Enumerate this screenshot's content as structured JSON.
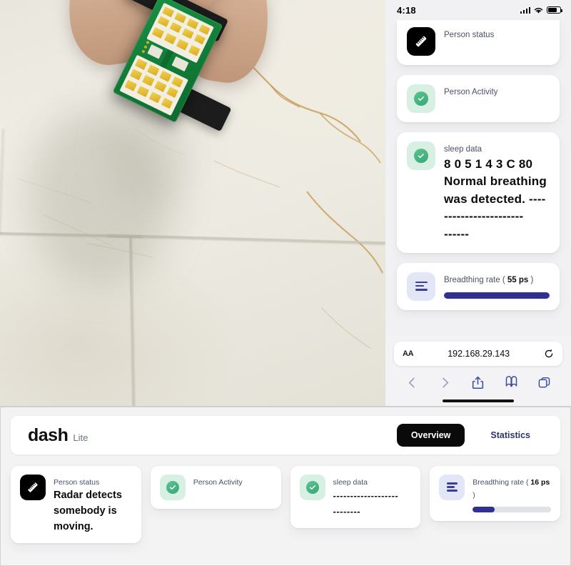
{
  "photo": {
    "alt_name": "mmwave-radar-pcb-over-marble-floor",
    "subject": "hand holding green mmWave radar PCB with gold patch antenna array",
    "surface": "cream marble floor tiles with golden-brown veins",
    "colors": {
      "pcb_green": "#15803d",
      "pad_gold": "#e7c33c",
      "marble": "#ebe8df",
      "vein": "#c9953f"
    }
  },
  "phone": {
    "status_bar": {
      "time": "4:18",
      "signal_icon": "signal-bars-icon",
      "wifi_icon": "wifi-icon",
      "battery_icon": "battery-icon"
    },
    "cards": [
      {
        "icon": "ruler-icon",
        "icon_style": "black",
        "label": "Person status",
        "value": ""
      },
      {
        "icon": "check-circle-icon",
        "icon_style": "mint",
        "label": "Person Activity",
        "value": ""
      },
      {
        "icon": "check-circle-icon",
        "icon_style": "mint",
        "label": "sleep data",
        "hex": "8 0 5 1 4 3 C 80",
        "value": "Normal breathing was detected.  ----",
        "dashes1": "-------------------",
        "dashes2": "------"
      },
      {
        "icon": "lines-icon",
        "icon_style": "lavender",
        "label": "Breadthing rate ( ",
        "rate": "55 ps",
        "label_tail": " )",
        "progress": 100,
        "progress_color": "#2e3192"
      }
    ],
    "browser": {
      "aa_label": "AA",
      "url": "192.168.29.143",
      "reload_icon": "reload-icon",
      "back_icon": "chevron-left-icon",
      "forward_icon": "chevron-right-icon",
      "share_icon": "share-icon",
      "bookmarks_icon": "book-icon",
      "tabs_icon": "tabs-icon"
    }
  },
  "dash": {
    "brand_name": "dash",
    "brand_suffix": "Lite",
    "tabs": [
      {
        "label": "Overview",
        "active": true
      },
      {
        "label": "Statistics",
        "active": false
      }
    ],
    "cards": [
      {
        "icon": "ruler-icon",
        "icon_style": "black",
        "label": "Person status",
        "value": "Radar detects somebody is moving."
      },
      {
        "icon": "check-circle-icon",
        "icon_style": "mint",
        "label": "Person Activity",
        "value": ""
      },
      {
        "icon": "check-circle-icon",
        "icon_style": "mint",
        "label": "sleep data",
        "dashes1": "-------------------",
        "dashes2": "--------"
      },
      {
        "icon": "lines-icon",
        "icon_style": "lavender",
        "label": "Breadthing rate ( ",
        "rate": "16 ps",
        "label_tail": " )",
        "progress": 28,
        "progress_color": "#2e3192"
      }
    ]
  },
  "colors": {
    "accent_blue": "#2e3192",
    "mint": "#d7f0e3",
    "green_check": "#41b883",
    "lavender": "#e3e6f7",
    "panel_bg": "#f1f1f3",
    "card_bg": "#ffffff"
  }
}
